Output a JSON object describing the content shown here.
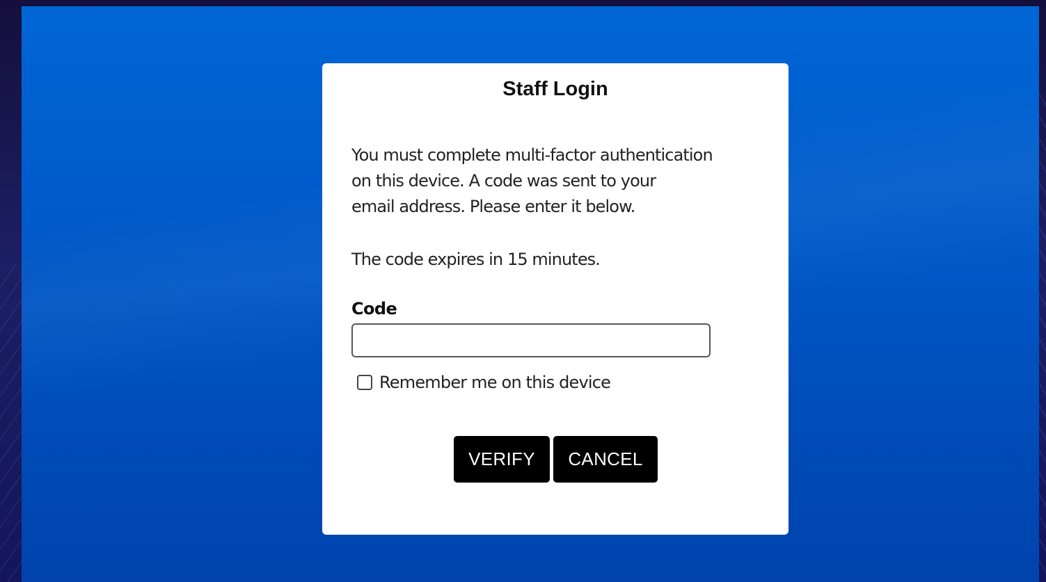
{
  "login": {
    "title": "Staff Login",
    "message_lines": [
      "You must complete multi-factor authentication",
      "on this device. A code was sent to your",
      "email address. Please enter it below."
    ],
    "expiry_text": "The code expires in 15 minutes.",
    "code_label": "Code",
    "code_value": "",
    "remember_label": "Remember me on this device",
    "remember_checked": false,
    "verify_label": "VERIFY",
    "cancel_label": "CANCEL"
  },
  "colors": {
    "background_blue": "#0059c9",
    "card": "#ffffff",
    "button": "#000000",
    "button_text": "#ffffff"
  }
}
